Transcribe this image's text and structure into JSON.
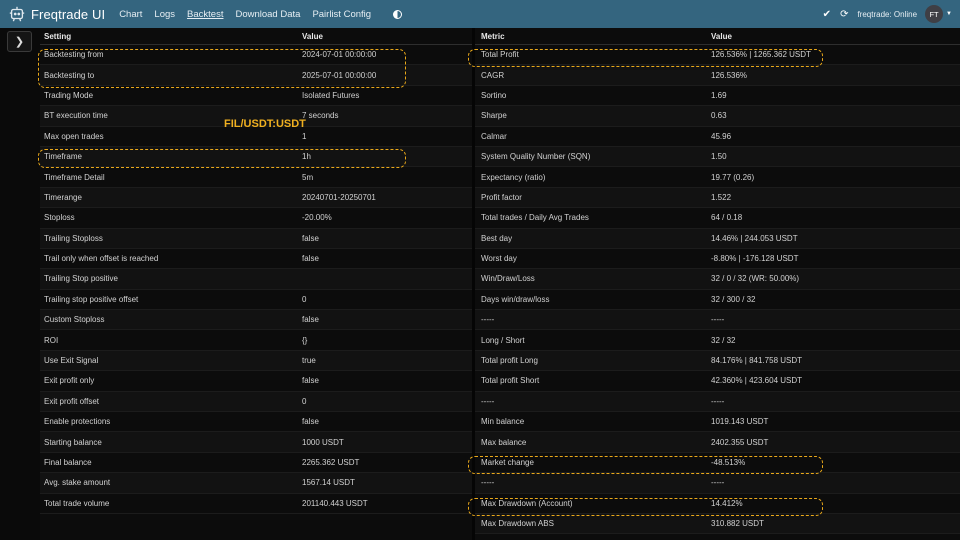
{
  "app": {
    "title": "Freqtrade UI",
    "nav": [
      {
        "label": "Chart",
        "active": false
      },
      {
        "label": "Logs",
        "active": false
      },
      {
        "label": "Backtest",
        "active": true
      },
      {
        "label": "Download Data",
        "active": false
      },
      {
        "label": "Pairlist Config",
        "active": false
      }
    ],
    "status": "freqtrade: Online",
    "avatar_initials": "FT",
    "icons": [
      "bot-logo-icon",
      "theme-toggle-icon",
      "check-icon",
      "refresh-icon",
      "caret-down-icon",
      "chevron-right-icon"
    ]
  },
  "annotation": {
    "pair_label": "FIL/USDT:USDT",
    "highlight_color": "#e9a81a"
  },
  "left_table": {
    "headers": [
      "Setting",
      "Value"
    ],
    "rows": [
      [
        "Backtesting from",
        "2024-07-01 00:00:00"
      ],
      [
        "Backtesting to",
        "2025-07-01 00:00:00"
      ],
      [
        "Trading Mode",
        "Isolated Futures"
      ],
      [
        "BT execution time",
        "7 seconds"
      ],
      [
        "Max open trades",
        "1"
      ],
      [
        "Timeframe",
        "1h"
      ],
      [
        "Timeframe Detail",
        "5m"
      ],
      [
        "Timerange",
        "20240701-20250701"
      ],
      [
        "Stoploss",
        "-20.00%"
      ],
      [
        "Trailing Stoploss",
        "false"
      ],
      [
        "Trail only when offset is reached",
        "false"
      ],
      [
        "Trailing Stop positive",
        ""
      ],
      [
        "Trailing stop positive offset",
        "0"
      ],
      [
        "Custom Stoploss",
        "false"
      ],
      [
        "ROI",
        "{}"
      ],
      [
        "Use Exit Signal",
        "true"
      ],
      [
        "Exit profit only",
        "false"
      ],
      [
        "Exit profit offset",
        "0"
      ],
      [
        "Enable protections",
        "false"
      ],
      [
        "Starting balance",
        "1000 USDT"
      ],
      [
        "Final balance",
        "2265.362 USDT"
      ],
      [
        "Avg. stake amount",
        "1567.14 USDT"
      ],
      [
        "Total trade volume",
        "201140.443 USDT"
      ]
    ]
  },
  "right_table": {
    "headers": [
      "Metric",
      "Value"
    ],
    "rows": [
      [
        "Total Profit",
        "126.536% | 1265.362 USDT"
      ],
      [
        "CAGR",
        "126.536%"
      ],
      [
        "Sortino",
        "1.69"
      ],
      [
        "Sharpe",
        "0.63"
      ],
      [
        "Calmar",
        "45.96"
      ],
      [
        "System Quality Number (SQN)",
        "1.50"
      ],
      [
        "Expectancy (ratio)",
        "19.77 (0.26)"
      ],
      [
        "Profit factor",
        "1.522"
      ],
      [
        "Total trades / Daily Avg Trades",
        "64 / 0.18"
      ],
      [
        "Best day",
        "14.46% | 244.053 USDT"
      ],
      [
        "Worst day",
        "-8.80% | -176.128 USDT"
      ],
      [
        "Win/Draw/Loss",
        "32 / 0 / 32 (WR: 50.00%)"
      ],
      [
        "Days win/draw/loss",
        "32 / 300 / 32"
      ],
      [
        "-----",
        "-----"
      ],
      [
        "Long / Short",
        "32 / 32"
      ],
      [
        "Total profit Long",
        "84.176% | 841.758 USDT"
      ],
      [
        "Total profit Short",
        "42.360% | 423.604 USDT"
      ],
      [
        "-----",
        "-----"
      ],
      [
        "Min balance",
        "1019.143 USDT"
      ],
      [
        "Max balance",
        "2402.355 USDT"
      ],
      [
        "Market change",
        "-48.513%"
      ],
      [
        "-----",
        "-----"
      ],
      [
        "Max Drawdown (Account)",
        "14.412%"
      ],
      [
        "Max Drawdown ABS",
        "310.882 USDT"
      ]
    ]
  }
}
